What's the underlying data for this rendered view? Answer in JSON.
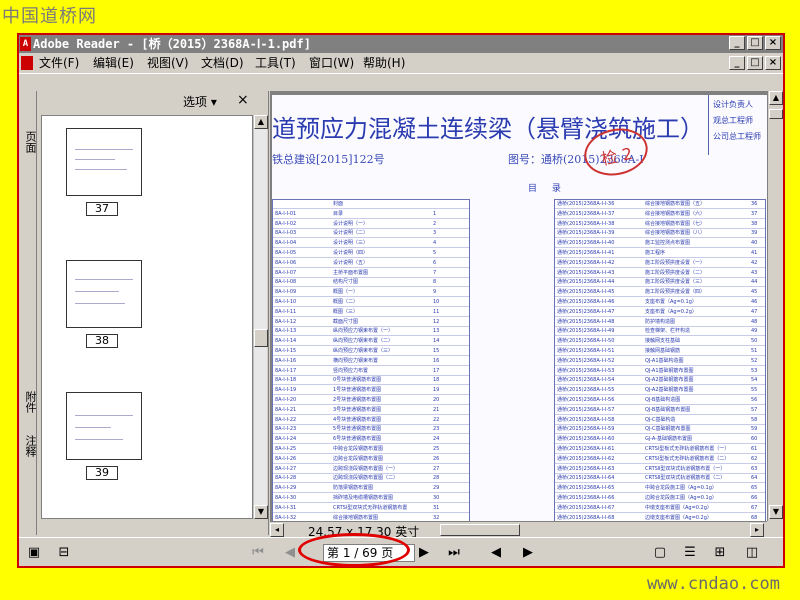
{
  "watermarks": {
    "top_left": "中国道桥网",
    "bottom_right": "www.cndao.com"
  },
  "window": {
    "title": "Adobe Reader - [桥（2015）2368A-Ⅰ-1.pdf]",
    "app_icon": "adobe-icon",
    "controls": [
      "_",
      "□",
      "×"
    ]
  },
  "menu": [
    "文件(F)",
    "编辑(E)",
    "视图(V)",
    "文档(D)",
    "工具(T)",
    "窗口(W)",
    "帮助(H)"
  ],
  "sidebar": {
    "tabs": [
      "页面",
      "附件",
      "注释"
    ],
    "options_label": "选项 ▾",
    "close_label": "×",
    "thumbnails": [
      "37",
      "38",
      "39"
    ]
  },
  "document": {
    "title": "道预应力混凝土连续梁（悬臂浇筑施工）",
    "subtitle": "铁总建设[2015]122号",
    "code": "图号：通桥(2015)2368A-Ⅰ",
    "stamp": "检 2",
    "right_box": [
      "设计负责人",
      "观总工程师",
      "公司总工程师"
    ],
    "contents_heading": "目 录",
    "left_table": [
      [
        "",
        "封面",
        ""
      ],
      [
        "8A-Ⅰ-Ⅰ-01",
        "目录",
        "1"
      ],
      [
        "8A-Ⅰ-Ⅰ-02",
        "设计说明（一）",
        "2"
      ],
      [
        "8A-Ⅰ-Ⅰ-03",
        "设计说明（二）",
        "3"
      ],
      [
        "8A-Ⅰ-Ⅰ-04",
        "设计说明（三）",
        "4"
      ],
      [
        "8A-Ⅰ-Ⅰ-05",
        "设计说明（四）",
        "5"
      ],
      [
        "8A-Ⅰ-Ⅰ-06",
        "设计说明（五）",
        "6"
      ],
      [
        "8A-Ⅰ-Ⅰ-07",
        "主桥平面布置图",
        "7"
      ],
      [
        "8A-Ⅰ-Ⅰ-08",
        "结构尺寸图",
        "8"
      ],
      [
        "8A-Ⅰ-Ⅰ-09",
        "概图（一）",
        "9"
      ],
      [
        "8A-Ⅰ-Ⅰ-10",
        "概图（二）",
        "10"
      ],
      [
        "8A-Ⅰ-Ⅰ-11",
        "概图（三）",
        "11"
      ],
      [
        "8A-Ⅰ-Ⅰ-12",
        "截面尺寸图",
        "12"
      ],
      [
        "8A-Ⅰ-Ⅰ-13",
        "纵向预应力钢束布置（一）",
        "13"
      ],
      [
        "8A-Ⅰ-Ⅰ-14",
        "纵向预应力钢束布置（二）",
        "14"
      ],
      [
        "8A-Ⅰ-Ⅰ-15",
        "纵向预应力钢束布置（三）",
        "15"
      ],
      [
        "8A-Ⅰ-Ⅰ-16",
        "横向预应力钢束布置",
        "16"
      ],
      [
        "8A-Ⅰ-Ⅰ-17",
        "竖向预应力布置",
        "17"
      ],
      [
        "8A-Ⅰ-Ⅰ-18",
        "0号块普通钢筋布置图",
        "18"
      ],
      [
        "8A-Ⅰ-Ⅰ-19",
        "1号块普通钢筋布置图",
        "19"
      ],
      [
        "8A-Ⅰ-Ⅰ-20",
        "2号块普通钢筋布置图",
        "20"
      ],
      [
        "8A-Ⅰ-Ⅰ-21",
        "3号块普通钢筋布置图",
        "21"
      ],
      [
        "8A-Ⅰ-Ⅰ-22",
        "4号块普通钢筋布置图",
        "22"
      ],
      [
        "8A-Ⅰ-Ⅰ-23",
        "5号块普通钢筋布置图",
        "23"
      ],
      [
        "8A-Ⅰ-Ⅰ-24",
        "6号块普通钢筋布置图",
        "24"
      ],
      [
        "8A-Ⅰ-Ⅰ-25",
        "中跨合龙段钢筋布置图",
        "25"
      ],
      [
        "8A-Ⅰ-Ⅰ-26",
        "边跨合龙段钢筋布置图",
        "26"
      ],
      [
        "8A-Ⅰ-Ⅰ-27",
        "边跨现浇段钢筋布置图（一）",
        "27"
      ],
      [
        "8A-Ⅰ-Ⅰ-28",
        "边跨现浇段钢筋布置图（二）",
        "28"
      ],
      [
        "8A-Ⅰ-Ⅰ-29",
        "防落梁钢筋布置图",
        "29"
      ],
      [
        "8A-Ⅰ-Ⅰ-30",
        "挡砟墙及电缆槽钢筋布置图",
        "30"
      ],
      [
        "8A-Ⅰ-Ⅰ-31",
        "CRTSⅠ型双块式无砟轨道钢筋布置",
        "31"
      ],
      [
        "8A-Ⅰ-Ⅰ-32",
        "综合接地钢筋布置图",
        "32"
      ]
    ],
    "right_table": [
      [
        "通桥(2015)2368A-Ⅰ-Ⅰ-36",
        "综合接地钢筋布置图（五）",
        "36"
      ],
      [
        "通桥(2015)2368A-Ⅰ-Ⅰ-37",
        "综合接地钢筋布置图（六）",
        "37"
      ],
      [
        "通桥(2015)2368A-Ⅰ-Ⅰ-38",
        "综合接地钢筋布置图（七）",
        "38"
      ],
      [
        "通桥(2015)2368A-Ⅰ-Ⅰ-39",
        "综合接地钢筋布置图（八）",
        "39"
      ],
      [
        "通桥(2015)2368A-Ⅰ-Ⅰ-40",
        "施工监控测点布置图",
        "40"
      ],
      [
        "通桥(2015)2368A-Ⅰ-Ⅰ-41",
        "施工程序",
        "41"
      ],
      [
        "通桥(2015)2368A-Ⅰ-Ⅰ-42",
        "施工阶段预拱度设置（一）",
        "42"
      ],
      [
        "通桥(2015)2368A-Ⅰ-Ⅰ-43",
        "施工阶段预拱度设置（二）",
        "43"
      ],
      [
        "通桥(2015)2368A-Ⅰ-Ⅰ-44",
        "施工阶段预拱度设置（三）",
        "44"
      ],
      [
        "通桥(2015)2368A-Ⅰ-Ⅰ-45",
        "施工阶段预拱度设置（四）",
        "45"
      ],
      [
        "通桥(2015)2368A-Ⅰ-Ⅰ-46",
        "支座布置（Ag=0.1g）",
        "46"
      ],
      [
        "通桥(2015)2368A-Ⅰ-Ⅰ-47",
        "支座布置（Ag=0.2g）",
        "47"
      ],
      [
        "通桥(2015)2368A-Ⅰ-Ⅰ-48",
        "防护墙构造图",
        "48"
      ],
      [
        "通桥(2015)2368A-Ⅰ-Ⅰ-49",
        "检查梯架、栏杆构造",
        "49"
      ],
      [
        "通桥(2015)2368A-Ⅰ-Ⅰ-50",
        "接触网支柱基础",
        "50"
      ],
      [
        "通桥(2015)2368A-Ⅰ-Ⅰ-51",
        "接触网基础钢筋",
        "51"
      ],
      [
        "通桥(2015)2368A-Ⅰ-Ⅰ-52",
        "QJ-A1基础构造图",
        "52"
      ],
      [
        "通桥(2015)2368A-Ⅰ-Ⅰ-53",
        "QJ-A1基础钢筋布置图",
        "53"
      ],
      [
        "通桥(2015)2368A-Ⅰ-Ⅰ-54",
        "QJ-A2基础钢筋布置图",
        "54"
      ],
      [
        "通桥(2015)2368A-Ⅰ-Ⅰ-55",
        "QJ-A2基础钢筋布置图",
        "55"
      ],
      [
        "通桥(2015)2368A-Ⅰ-Ⅰ-56",
        "QJ-B基础构造图",
        "56"
      ],
      [
        "通桥(2015)2368A-Ⅰ-Ⅰ-57",
        "QJ-B基础钢筋布置图",
        "57"
      ],
      [
        "通桥(2015)2368A-Ⅰ-Ⅰ-58",
        "QJ-C基础构造",
        "58"
      ],
      [
        "通桥(2015)2368A-Ⅰ-Ⅰ-59",
        "QJ-C基础钢筋布置图",
        "59"
      ],
      [
        "通桥(2015)2368A-Ⅰ-Ⅰ-60",
        "GJ-A-基础钢筋布置图",
        "60"
      ],
      [
        "通桥(2015)2368A-Ⅰ-Ⅰ-61",
        "CRTSⅠ型板式无砟轨道钢筋布置（一）",
        "61"
      ],
      [
        "通桥(2015)2368A-Ⅰ-Ⅰ-62",
        "CRTSⅠ型板式无砟轨道钢筋布置（二）",
        "62"
      ],
      [
        "通桥(2015)2368A-Ⅰ-Ⅰ-63",
        "CRTSⅡ型双块式轨道钢筋布置（一）",
        "63"
      ],
      [
        "通桥(2015)2368A-Ⅰ-Ⅰ-64",
        "CRTSⅡ型双块式轨道钢筋布置（二）",
        "64"
      ],
      [
        "通桥(2015)2368A-Ⅰ-Ⅰ-65",
        "中跨合龙段施工图（Ag=0.1g）",
        "65"
      ],
      [
        "通桥(2015)2368A-Ⅰ-Ⅰ-66",
        "边跨合龙段施工图（Ag=0.1g）",
        "66"
      ],
      [
        "通桥(2015)2368A-Ⅰ-Ⅰ-67",
        "中墩支座布置图（Ag=0.2g）",
        "67"
      ],
      [
        "通桥(2015)2368A-Ⅰ-Ⅰ-68",
        "边墩支座布置图（Ag=0.2g）",
        "68"
      ]
    ]
  },
  "page_size": "24.57 x 17.30 英寸",
  "navigation": {
    "page_display": "第 1 / 69 页"
  },
  "status_icons": [
    "single-page-icon",
    "continuous-icon",
    "facing-icon",
    "continuous-facing-icon"
  ]
}
